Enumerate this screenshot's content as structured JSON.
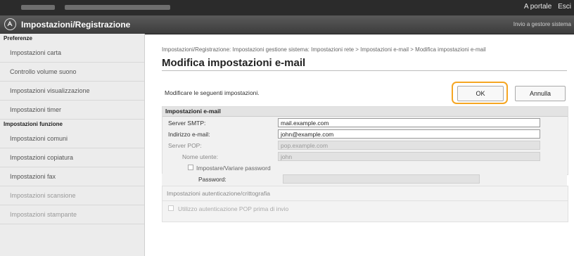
{
  "topbar": {
    "portal_link": "A portale",
    "exit_link": "Esci"
  },
  "header": {
    "title": "Impostazioni/Registrazione",
    "right_link": "Invio a gestore sistema"
  },
  "sidebar": {
    "group_preferences": "Preferenze",
    "pref_items": [
      "Impostazioni carta",
      "Controllo volume suono",
      "Impostazioni visualizzazione",
      "Impostazioni timer"
    ],
    "group_functions": "Impostazioni funzione",
    "func_items": [
      "Impostazioni comuni",
      "Impostazioni copiatura",
      "Impostazioni fax",
      "Impostazioni scansione",
      "Impostazioni stampante"
    ]
  },
  "main": {
    "breadcrumb": "Impostazioni/Registrazione: Impostazioni gestione sistema: Impostazioni rete > Impostazioni e-mail > Modifica impostazioni e-mail",
    "page_title": "Modifica impostazioni e-mail",
    "instruction": "Modificare le seguenti impostazioni.",
    "ok_label": "OK",
    "cancel_label": "Annulla",
    "section_title": "Impostazioni e-mail",
    "smtp_label": "Server SMTP:",
    "smtp_value": "mail.example.com",
    "email_label": "Indirizzo e-mail:",
    "email_value": "john@example.com",
    "pop_label": "Server POP:",
    "pop_value": "pop.example.com",
    "user_label": "Nome utente:",
    "user_value": "john",
    "setpw_label": "Impostare/Variare password",
    "password_label": "Password:",
    "password_value": "",
    "auth_section_title": "Impostazioni autenticazione/crittografia",
    "pop_before_send_label": "Utilizzo autenticazione POP prima di invio"
  },
  "colors": {
    "highlight": "#f5a623",
    "header_bg": "#3c3c3c"
  }
}
